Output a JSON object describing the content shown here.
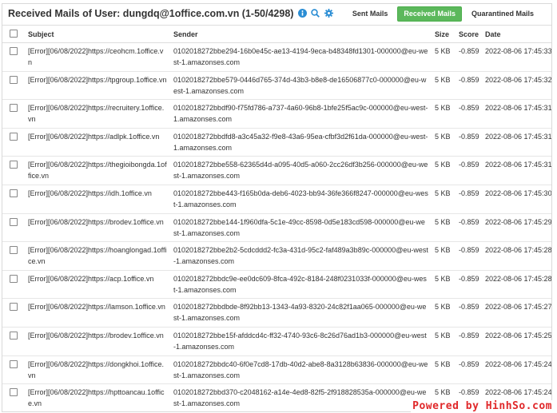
{
  "header": {
    "title": "Received Mails of User: dungdq@1office.com.vn (1-50/4298)",
    "buttons": {
      "sent": "Sent Mails",
      "received": "Received Mails",
      "quarantined": "Quarantined Mails"
    }
  },
  "columns": {
    "subject": "Subject",
    "sender": "Sender",
    "size": "Size",
    "score": "Score",
    "date": "Date"
  },
  "rows": [
    {
      "subject": "[Error][06/08/2022]https://ceohcm.1office.vn",
      "sender": "0102018272bbe294-16b0e45c-ae13-4194-9eca-b48348fd1301-000000@eu-west-1.amazonses.com",
      "size": "5 KB",
      "score": "-0.859",
      "date": "2022-08-06 17:45:33"
    },
    {
      "subject": "[Error][06/08/2022]https://tpgroup.1office.vn",
      "sender": "0102018272bbe579-0446d765-374d-43b3-b8e8-de16506877c0-000000@eu-west-1.amazonses.com",
      "size": "5 KB",
      "score": "-0.859",
      "date": "2022-08-06 17:45:32"
    },
    {
      "subject": "[Error][06/08/2022]https://recruitery.1office.vn",
      "sender": "0102018272bbdf90-f75fd786-a737-4a60-96b8-1bfe25f5ac9c-000000@eu-west-1.amazonses.com",
      "size": "5 KB",
      "score": "-0.859",
      "date": "2022-08-06 17:45:31"
    },
    {
      "subject": "[Error][06/08/2022]https://adlpk.1office.vn",
      "sender": "0102018272bbdfd8-a3c45a32-f9e8-43a6-95ea-cfbf3d2f61da-000000@eu-west-1.amazonses.com",
      "size": "5 KB",
      "score": "-0.859",
      "date": "2022-08-06 17:45:31"
    },
    {
      "subject": "[Error][06/08/2022]https://thegioibongda.1office.vn",
      "sender": "0102018272bbe558-62365d4d-a095-40d5-a060-2cc26df3b256-000000@eu-west-1.amazonses.com",
      "size": "5 KB",
      "score": "-0.859",
      "date": "2022-08-06 17:45:31"
    },
    {
      "subject": "[Error][06/08/2022]https://idh.1office.vn",
      "sender": "0102018272bbe443-f165b0da-deb6-4023-bb94-36fe366f8247-000000@eu-west-1.amazonses.com",
      "size": "5 KB",
      "score": "-0.859",
      "date": "2022-08-06 17:45:30"
    },
    {
      "subject": "[Error][06/08/2022]https://brodev.1office.vn",
      "sender": "0102018272bbe144-1f960dfa-5c1e-49cc-8598-0d5e183cd598-000000@eu-west-1.amazonses.com",
      "size": "5 KB",
      "score": "-0.859",
      "date": "2022-08-06 17:45:29"
    },
    {
      "subject": "[Error][06/08/2022]https://hoanglongad.1office.vn",
      "sender": "0102018272bbe2b2-5cdcddd2-fc3a-431d-95c2-faf489a3b89c-000000@eu-west-1.amazonses.com",
      "size": "5 KB",
      "score": "-0.859",
      "date": "2022-08-06 17:45:28"
    },
    {
      "subject": "[Error][06/08/2022]https://acp.1office.vn",
      "sender": "0102018272bbdc9e-ee0dc609-8fca-492c-8184-248f0231033f-000000@eu-west-1.amazonses.com",
      "size": "5 KB",
      "score": "-0.859",
      "date": "2022-08-06 17:45:28"
    },
    {
      "subject": "[Error][06/08/2022]https://lamson.1office.vn",
      "sender": "0102018272bbdbde-8f92bb13-1343-4a93-8320-24c82f1aa065-000000@eu-west-1.amazonses.com",
      "size": "5 KB",
      "score": "-0.859",
      "date": "2022-08-06 17:45:27"
    },
    {
      "subject": "[Error][06/08/2022]https://brodev.1office.vn",
      "sender": "0102018272bbe15f-afddcd4c-ff32-4740-93c6-8c26d76ad1b3-000000@eu-west-1.amazonses.com",
      "size": "5 KB",
      "score": "-0.859",
      "date": "2022-08-06 17:45:25"
    },
    {
      "subject": "[Error][06/08/2022]https://dongkhoi.1office.vn",
      "sender": "0102018272bbdc40-6f0e7cd8-17db-40d2-abe8-8a3128b63836-000000@eu-west-1.amazonses.com",
      "size": "5 KB",
      "score": "-0.859",
      "date": "2022-08-06 17:45:24"
    },
    {
      "subject": "[Error][06/08/2022]https://hpttoancau.1office.vn",
      "sender": "0102018272bbd370-c2048162-a14e-4ed8-82f5-2f918828535a-000000@eu-west-1.amazonses.com",
      "size": "5 KB",
      "score": "-0.859",
      "date": "2022-08-06 17:45:24"
    }
  ],
  "watermark": "Powered by HinhSo.com",
  "colors": {
    "active_button": "#5cb85c",
    "icon_blue": "#2a8dd4",
    "watermark": "#e0282a"
  },
  "icons": [
    "info-icon",
    "search-icon",
    "gear-icon",
    "checkbox"
  ]
}
